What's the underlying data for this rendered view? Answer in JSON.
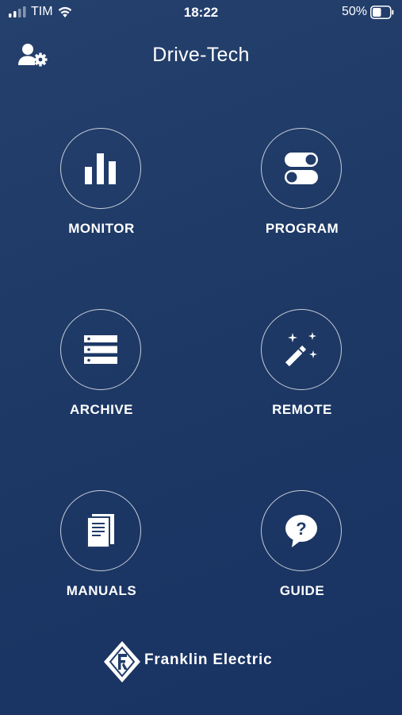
{
  "status_bar": {
    "carrier": "TIM",
    "time": "18:22",
    "battery_percent": "50%"
  },
  "header": {
    "title": "Drive-Tech",
    "user_settings_icon": "user-gear-icon"
  },
  "menu": {
    "items": [
      {
        "label": "MONITOR",
        "icon": "bar-chart-icon"
      },
      {
        "label": "PROGRAM",
        "icon": "toggles-icon"
      },
      {
        "label": "ARCHIVE",
        "icon": "server-stack-icon"
      },
      {
        "label": "REMOTE",
        "icon": "magic-wand-icon"
      },
      {
        "label": "MANUALS",
        "icon": "book-icon"
      },
      {
        "label": "GUIDE",
        "icon": "question-bubble-icon"
      }
    ]
  },
  "footer": {
    "brand": "Franklin Electric",
    "brand_logo_icon": "franklin-electric-logo"
  },
  "colors": {
    "background": "#1e3965",
    "foreground": "#ffffff"
  }
}
